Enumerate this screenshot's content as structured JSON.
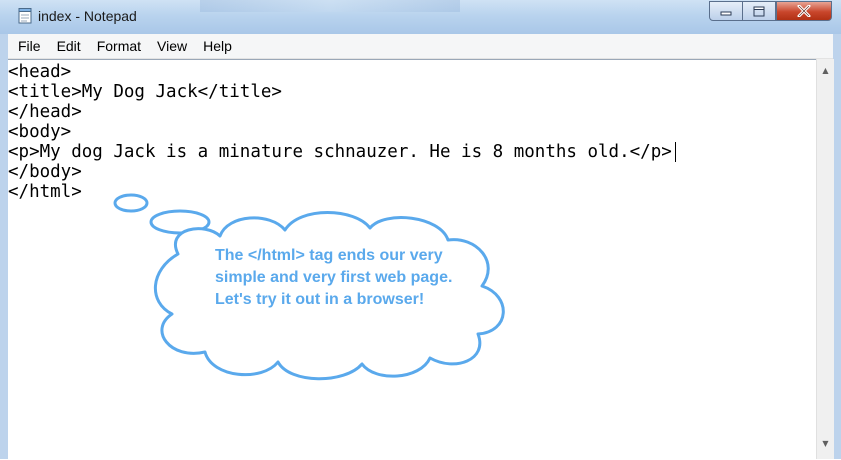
{
  "window": {
    "title": "index - Notepad",
    "icon": "notepad-icon",
    "left_edge_char": "e",
    "controls": {
      "minimize": "minimize-icon",
      "maximize": "maximize-icon",
      "close": "close-icon"
    }
  },
  "menu": {
    "items": [
      {
        "label": "File"
      },
      {
        "label": "Edit"
      },
      {
        "label": "Format"
      },
      {
        "label": "View"
      },
      {
        "label": "Help"
      }
    ]
  },
  "editor": {
    "lines": [
      "<head>",
      "<title>My Dog Jack</title>",
      "</head>",
      "<body>",
      "<p>My dog Jack is a minature schnauzer. He is 8 months old.</p>",
      "</body>",
      "</html>"
    ]
  },
  "callout": {
    "text": "The </html> tag ends our very simple and very first web page. Let's try it out in a browser!",
    "color": "#5aa9ec"
  },
  "colors": {
    "titlebar": "#b9d3ee",
    "close_button": "#c9462c",
    "callout_stroke": "#5aa9ec"
  }
}
